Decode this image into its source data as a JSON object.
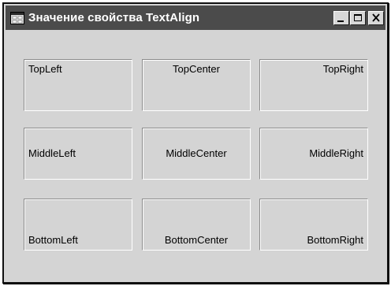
{
  "window": {
    "title": "Значение свойства TextAlign",
    "icon": "app-window-icon",
    "buttons": {
      "minimize_icon": "minimize-icon",
      "maximize_icon": "maximize-icon",
      "close_icon": "close-icon"
    }
  },
  "labels": {
    "top_left": "TopLeft",
    "top_center": "TopCenter",
    "top_right": "TopRight",
    "middle_left": "MiddleLeft",
    "middle_center": "MiddleCenter",
    "middle_right": "MiddleRight",
    "bottom_left": "BottomLeft",
    "bottom_center": "BottomCenter",
    "bottom_right": "BottomRight"
  }
}
